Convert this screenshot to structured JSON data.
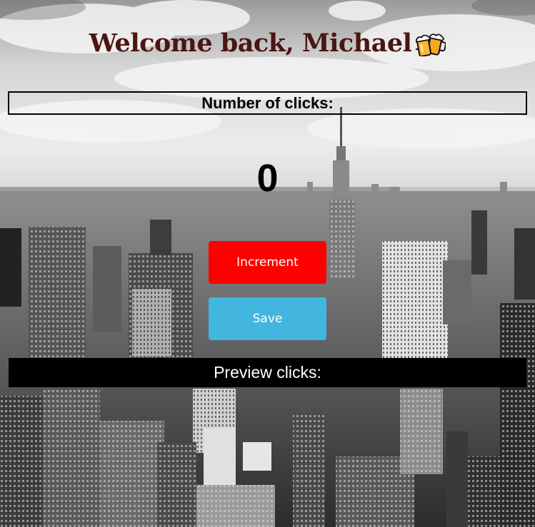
{
  "header": {
    "welcome_text": "Welcome back, Michael",
    "emoji_icon": "beer-mugs-icon"
  },
  "counter": {
    "label": "Number of clicks:",
    "value": "0"
  },
  "buttons": {
    "increment_label": "Increment",
    "save_label": "Save"
  },
  "preview": {
    "label": "Preview clicks:"
  },
  "colors": {
    "title": "#4a1512",
    "increment": "#ff0000",
    "save": "#42b6de",
    "preview_bg": "#000000"
  },
  "background": {
    "icon": "city-skyline-photo"
  }
}
